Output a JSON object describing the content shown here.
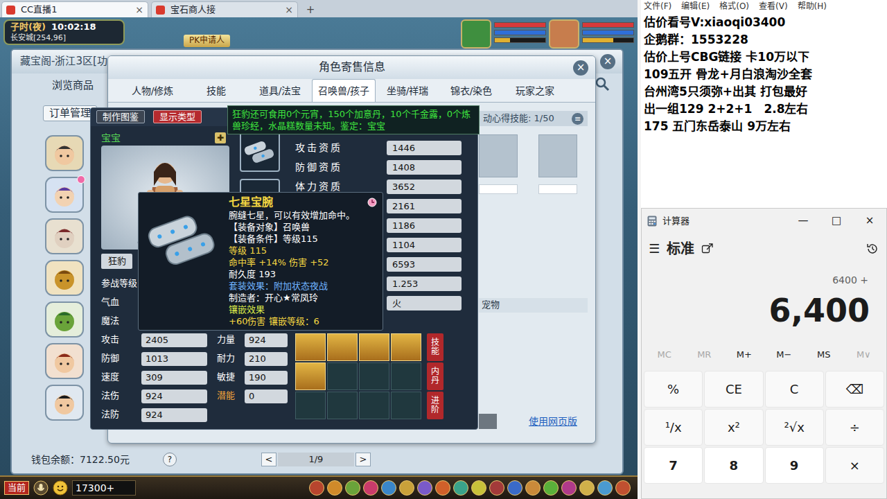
{
  "browser": {
    "tabs": [
      {
        "label": "CC直播1",
        "close": "×",
        "selected": true
      },
      {
        "label": "宝石商人接",
        "close": "×",
        "selected": false
      }
    ],
    "new_tab": "+"
  },
  "hud": {
    "period": "子时(夜)",
    "clock": "10:02:18",
    "location": "长安城[254,96]",
    "pk": "PK申请人",
    "portraits": [
      {
        "bars": [
          {
            "level": 1.0,
            "color": "#d83a3a"
          },
          {
            "level": 1.0,
            "color": "#2f6fd8"
          },
          {
            "level": 0.3,
            "color": "#e0b030"
          }
        ]
      },
      {
        "bars": [
          {
            "level": 1.0,
            "color": "#d83a3a"
          },
          {
            "level": 1.0,
            "color": "#2f6fd8"
          },
          {
            "level": 0.6,
            "color": "#e0b030"
          }
        ]
      }
    ]
  },
  "market": {
    "title": "藏宝阁-浙江3区[功",
    "close": "×",
    "nav": [
      {
        "label": "浏览商品",
        "kind": "link"
      },
      {
        "label": "订单管理",
        "kind": "button"
      }
    ],
    "wallet": "钱包余额：7122.50元",
    "help": "?",
    "prev": "<",
    "page": "1/9",
    "next": ">"
  },
  "dialog": {
    "title": "角色寄售信息",
    "close": "×",
    "tabs": [
      {
        "label": "人物/修炼",
        "selected": false
      },
      {
        "label": "技能",
        "selected": false
      },
      {
        "label": "道具/法宝",
        "selected": false
      },
      {
        "label": "召唤兽/孩子",
        "selected": true
      },
      {
        "label": "坐骑/祥瑞",
        "selected": false
      },
      {
        "label": "锦衣/染色",
        "selected": false
      },
      {
        "label": "玩家之家",
        "selected": false
      }
    ],
    "skill_header": "动心得技能: 1/50",
    "list_icon": "≡",
    "pet_section": "宠物",
    "web_link": "使用网页版"
  },
  "pet": {
    "buttons": [
      {
        "label": "制作图鉴",
        "kind": "plain"
      },
      {
        "label": "显示类型",
        "kind": "accent"
      }
    ],
    "type": "宝宝",
    "add": "✚",
    "name": "狂豹",
    "stats": [
      {
        "label": "参战等级",
        "value": ""
      },
      {
        "label": "气血",
        "value": ""
      },
      {
        "label": "魔法",
        "value": ""
      },
      {
        "label": "攻击",
        "value": "2405"
      },
      {
        "label": "防御",
        "value": "1013"
      },
      {
        "label": "速度",
        "value": "309"
      },
      {
        "label": "法伤",
        "value": "924"
      },
      {
        "label": "法防",
        "value": "924"
      }
    ],
    "side_stats": [
      {
        "label": "",
        "value": "",
        "color": "#ffffff"
      },
      {
        "label": "",
        "value": "",
        "color": "#ffffff"
      },
      {
        "label": "",
        "value": "",
        "color": "#ffffff"
      },
      {
        "label": "力量",
        "value": "924",
        "color": "#ffffff"
      },
      {
        "label": "耐力",
        "value": "210",
        "color": "#ffffff"
      },
      {
        "label": "敏捷",
        "value": "190",
        "color": "#ffffff"
      },
      {
        "label": "潜能",
        "value": "0",
        "color": "#f0a23a"
      }
    ],
    "aptitudes": [
      {
        "label": "攻击资质",
        "value": "1446"
      },
      {
        "label": "防御资质",
        "value": "1408"
      },
      {
        "label": "体力资质",
        "value": "3652"
      },
      {
        "label": "",
        "value": "2161"
      },
      {
        "label": "",
        "value": "1186"
      },
      {
        "label": "",
        "value": "1104"
      },
      {
        "label": "",
        "value": "6593"
      },
      {
        "label": "",
        "value": "1.253"
      },
      {
        "label": "",
        "value": "火"
      }
    ],
    "skills": [
      {
        "filled": true
      },
      {
        "filled": true
      },
      {
        "filled": true
      },
      {
        "filled": true
      },
      {
        "filled": true
      },
      {
        "filled": false
      },
      {
        "filled": false
      },
      {
        "filled": false
      },
      {
        "filled": false
      },
      {
        "filled": false
      },
      {
        "filled": false
      },
      {
        "filled": false
      }
    ],
    "side_buttons": [
      "技能",
      "内丹",
      "进阶"
    ]
  },
  "food_tip": "狂豹还可食用0个元宵，150个加意丹，10个千金露，0个炼兽珍经，水晶糕数量未知。鉴定：宝宝",
  "item_tip": {
    "name": "七星宝腕",
    "lines": [
      {
        "text": "腕缝七星，可以有效增加命中。",
        "color": "#ffffff"
      },
      {
        "text": "【装备对象】召唤兽",
        "color": "#ffffff"
      },
      {
        "text": "【装备条件】等级115",
        "color": "#ffffff"
      },
      {
        "text": "等级 115",
        "color": "#f5d742"
      },
      {
        "text": "命中率 +14% 伤害 +52",
        "color": "#f5d742"
      },
      {
        "text": "耐久度 193",
        "color": "#ffffff"
      },
      {
        "text": "套装效果：附加状态夜战",
        "color": "#6fb3ff"
      },
      {
        "text": "制造者：开心★常凤玲",
        "color": "#ffffff"
      },
      {
        "text": "镶嵌效果",
        "color": "#d8e84a"
      },
      {
        "text": "+60伤害 镶嵌等级：6",
        "color": "#f5d742"
      }
    ]
  },
  "game_bar": {
    "channel": "当前",
    "input": "17300+"
  },
  "notepad": {
    "menu": [
      "文件(F)",
      "编辑(E)",
      "格式(O)",
      "查看(V)",
      "帮助(H)"
    ],
    "lines": [
      "估价看号V:xiaoqi03400",
      "企鹅群：1553228",
      "估价上号CBG链接 卡10万以下",
      "109五开 骨龙+月白浪淘沙全套",
      "台州湾5只须弥+出其 打包最好",
      "出一组129 2+2+1　2.8左右",
      "175 五门东岳泰山 9万左右"
    ]
  },
  "calculator": {
    "title": "计算器",
    "controls": [
      "—",
      "□",
      "×"
    ],
    "menu_icon": "☰",
    "mode": "标准",
    "expression": "6400 +",
    "display": "6,400",
    "memory": [
      {
        "label": "MC",
        "disabled": true
      },
      {
        "label": "MR",
        "disabled": true
      },
      {
        "label": "M+",
        "disabled": false
      },
      {
        "label": "M−",
        "disabled": false
      },
      {
        "label": "MS",
        "disabled": false
      },
      {
        "label": "M∨",
        "disabled": true
      }
    ],
    "keys": [
      [
        {
          "label": "%",
          "kind": "fn"
        },
        {
          "label": "CE",
          "kind": "fn"
        },
        {
          "label": "C",
          "kind": "fn"
        },
        {
          "label": "⌫",
          "kind": "fn"
        }
      ],
      [
        {
          "label": "¹/x",
          "kind": "fn"
        },
        {
          "label": "x²",
          "kind": "fn"
        },
        {
          "label": "²√x",
          "kind": "fn"
        },
        {
          "label": "÷",
          "kind": "fn"
        }
      ],
      [
        {
          "label": "7",
          "kind": "digit"
        },
        {
          "label": "8",
          "kind": "digit"
        },
        {
          "label": "9",
          "kind": "digit"
        },
        {
          "label": "×",
          "kind": "fn"
        }
      ]
    ]
  }
}
